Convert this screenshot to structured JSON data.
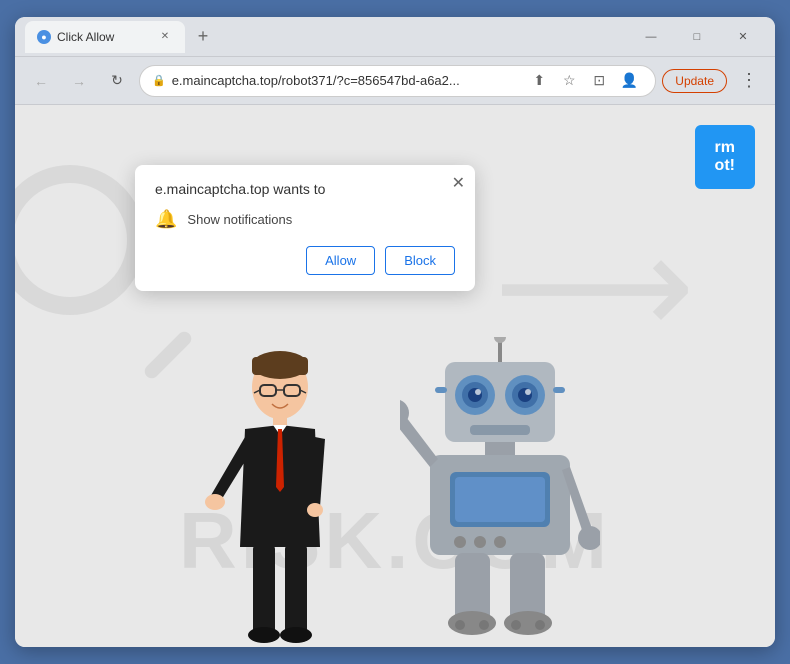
{
  "window": {
    "title": "Click Allow",
    "controls": {
      "minimize": "—",
      "maximize": "□",
      "close": "✕"
    }
  },
  "tab": {
    "favicon": "●",
    "title": "Click Allow",
    "close": "✕",
    "new_tab": "+"
  },
  "toolbar": {
    "back": "←",
    "forward": "→",
    "reload": "↻",
    "address": "e.maincaptcha.top/robot371/?c=856547bd-a6a2...",
    "share_icon": "⬡",
    "star_icon": "☆",
    "profile_icon": "👤",
    "update_label": "Update",
    "menu_icon": "⋮",
    "tab_icon": "⊡"
  },
  "popup": {
    "title": "e.maincaptcha.top wants to",
    "notification_text": "Show notifications",
    "close_icon": "✕",
    "allow_label": "Allow",
    "block_label": "Block"
  },
  "page": {
    "watermark": "RISK.COM",
    "confirm_btn_line1": "rm",
    "confirm_btn_line2": "ot!"
  },
  "colors": {
    "accent_blue": "#1a73e8",
    "browser_bg": "#dee1e6",
    "update_btn": "#d44000",
    "page_bg": "#e8e8e8"
  }
}
